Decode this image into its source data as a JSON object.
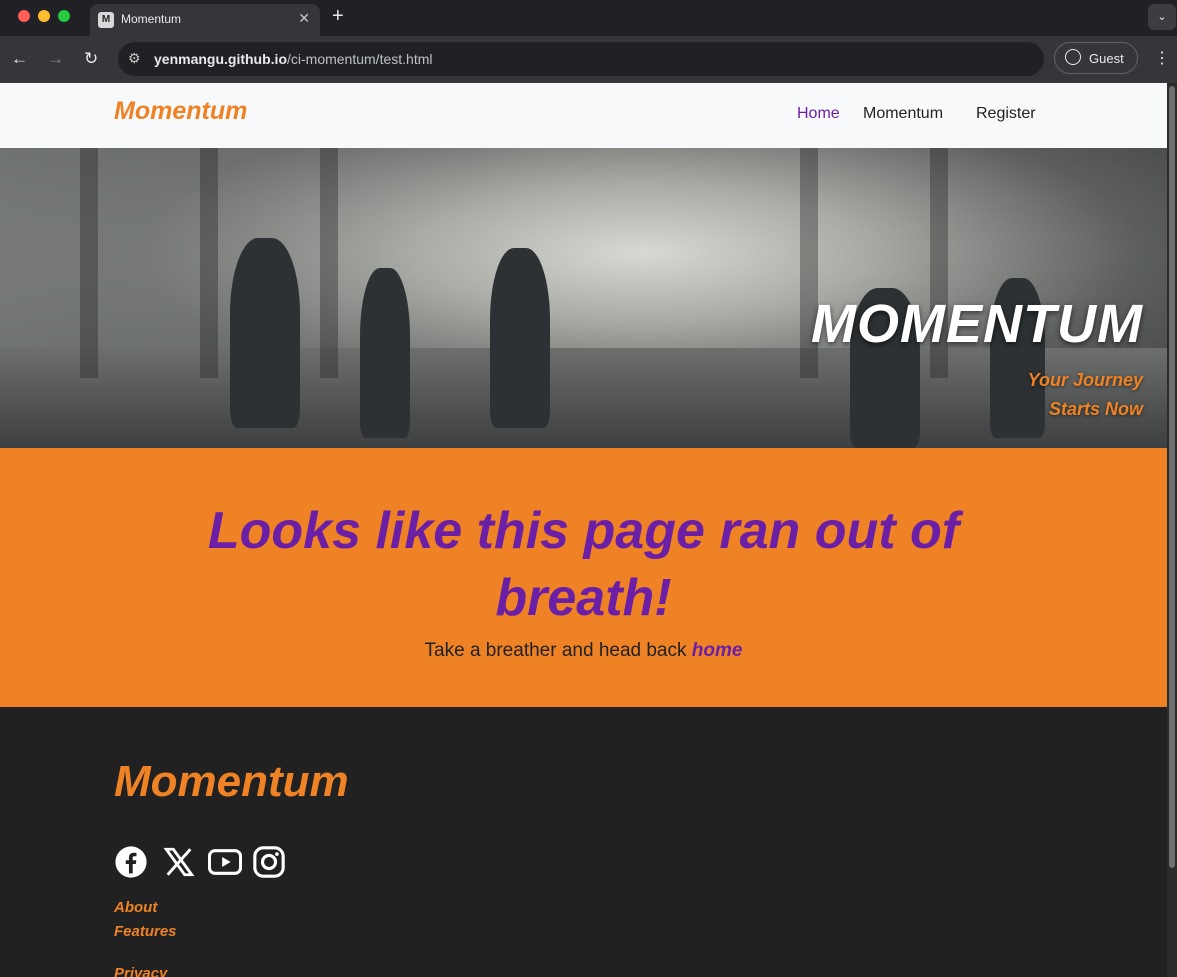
{
  "browser": {
    "tab_title": "Momentum",
    "favicon_text": "M",
    "url_host": "yenmangu.github.io",
    "url_path": "/ci-momentum/test.html",
    "profile_label": "Guest"
  },
  "navbar": {
    "brand": "Momentum",
    "links": [
      {
        "label": "Home",
        "active": true
      },
      {
        "label": "Momentum",
        "active": false
      },
      {
        "label": "Register",
        "active": false
      }
    ]
  },
  "hero": {
    "title": "MOMENTUM",
    "subtitle_line1": "Your Journey",
    "subtitle_line2": "Starts Now"
  },
  "not_found": {
    "heading": "Looks like this page ran out of breath!",
    "text": "Take a breather and head back ",
    "link_label": "home"
  },
  "footer": {
    "brand": "Momentum",
    "social_icons": [
      "facebook-icon",
      "x-icon",
      "youtube-icon",
      "instagram-icon"
    ],
    "links": [
      "About",
      "Features",
      "Privacy"
    ]
  },
  "colors": {
    "brand_orange": "#ee8224",
    "accent_purple": "#6a1fa6",
    "footer_bg": "#212121"
  }
}
